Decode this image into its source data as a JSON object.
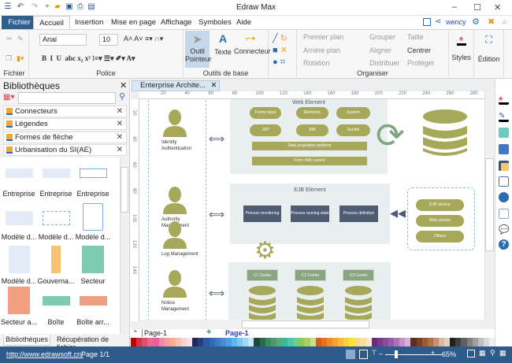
{
  "app": {
    "title": "Edraw Max"
  },
  "menu_tabs": [
    {
      "label": "Fichier"
    },
    {
      "label": "Accueil"
    },
    {
      "label": "Insertion"
    },
    {
      "label": "Mise en page"
    },
    {
      "label": "Affichage"
    },
    {
      "label": "Symboles"
    },
    {
      "label": "Aide"
    }
  ],
  "user": "wency",
  "ribbon": {
    "fichier_group": "Fichier",
    "police": {
      "label": "Police",
      "font": "Arial",
      "size": "10"
    },
    "outils": {
      "label": "Outils de base",
      "pointer_line1": "Outil",
      "pointer_line2": "Pointeur",
      "text": "Texte",
      "connector": "Connecteur"
    },
    "organiser": {
      "label": "Organiser",
      "items": [
        "Premier plan",
        "Arrière-plan",
        "Rotation",
        "Grouper",
        "Aligner",
        "Distribuer",
        "Taille",
        "Centrer",
        "Protéger"
      ]
    },
    "styles": "Styles",
    "edition": "Édition"
  },
  "library": {
    "title": "Bibliothèques",
    "categories": [
      "Connecteurs",
      "Légendes",
      "Formes de flèche",
      "Urbanisation du SI(AE)"
    ],
    "shapes": [
      {
        "label": "Entreprise"
      },
      {
        "label": "Entreprise"
      },
      {
        "label": "Entreprise"
      },
      {
        "label": "Modèle d..."
      },
      {
        "label": "Modèle d..."
      },
      {
        "label": "Modèle d..."
      },
      {
        "label": "Modèle d..."
      },
      {
        "label": "Gouverna..."
      },
      {
        "label": "Secteur"
      },
      {
        "label": "Secteur a..."
      },
      {
        "label": "Boîte"
      },
      {
        "label": "Boîte arr..."
      }
    ],
    "bottom_tabs": [
      "Bibliothèques",
      "Récupération de fichier"
    ]
  },
  "document": {
    "tab": "Enterprise Archite...",
    "ruler": [
      "20",
      "40",
      "60",
      "80",
      "100",
      "120",
      "140",
      "160",
      "180",
      "200",
      "220",
      "240",
      "260",
      "280"
    ],
    "vruler": [
      "20",
      "40",
      "60",
      "80",
      "100",
      "120",
      "140"
    ]
  },
  "diagram": {
    "actors": [
      "Identity Authentication",
      "Authority Management",
      "Log Management",
      "Notice Management"
    ],
    "web": {
      "title": "Web Element",
      "pills": [
        "Forms input",
        "Electronic",
        "System",
        "JSP",
        "JMF",
        "Servlet"
      ],
      "bars": [
        "Data acquisition platform",
        "Form XML control"
      ]
    },
    "ejb": {
      "title": "EJB Element",
      "boxes": [
        "Process monitoring",
        "Process running state",
        "Process definition"
      ]
    },
    "services": [
      "EJB service",
      "Web service",
      "Others"
    ],
    "centers": [
      "C1 Center",
      "C2 Center",
      "C3 Center"
    ]
  },
  "pages": {
    "select": "Page-1",
    "active": "Page-1"
  },
  "status": {
    "url": "http://www.edrawsoft.cn/",
    "page": "Page 1/1",
    "zoom": "65%",
    "zoom_level": 0.17
  },
  "palette": [
    "#c00000",
    "#d9334a",
    "#e0506a",
    "#e66a8a",
    "#ee5f9a",
    "#f08aa0",
    "#f5a0a0",
    "#f7b08a",
    "#f8c0b0",
    "#fad0d0",
    "#fbe0e8",
    "#1f2a5a",
    "#24407a",
    "#2a5aa0",
    "#3468b8",
    "#3c7ac8",
    "#4a8ad8",
    "#4aa0e0",
    "#5ab8f0",
    "#7ac8f0",
    "#a0d8f0",
    "#c8e8f8",
    "#1a4a3a",
    "#2a6a4a",
    "#3a8a5a",
    "#4a9a6a",
    "#5aaa7a",
    "#3ab89a",
    "#4ac8aa",
    "#6acf8a",
    "#8ac850",
    "#a8d060",
    "#c8e090",
    "#e05a1a",
    "#e8701a",
    "#f08a2a",
    "#f8a030",
    "#f8b840",
    "#f8d040",
    "#f8e820",
    "#f8d880",
    "#fae0a0",
    "#fbe8c8",
    "#6a2a7a",
    "#7a3a8a",
    "#8a4a9a",
    "#9a5aaa",
    "#b070b8",
    "#c890c8",
    "#d8b0d8",
    "#5a3020",
    "#7a4020",
    "#9a5a30",
    "#b07040",
    "#c89070",
    "#d8b8a0",
    "#e0d0c0",
    "#202020",
    "#404040",
    "#606060",
    "#808080",
    "#a0a0a0",
    "#c0c0c0",
    "#d8d8d8",
    "#f0f0f0"
  ]
}
